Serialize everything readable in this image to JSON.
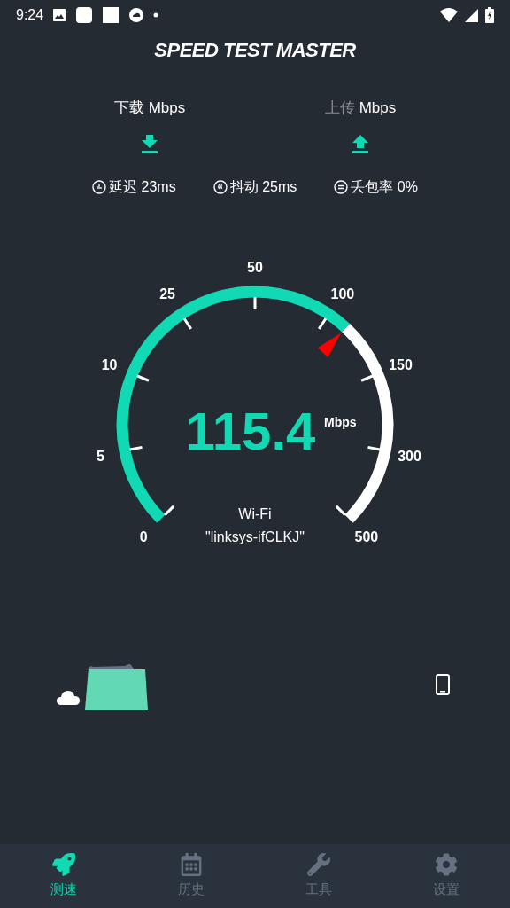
{
  "status_bar": {
    "time": "9:24"
  },
  "app_title": "SPEED TEST MASTER",
  "directions": [
    {
      "kind": "download",
      "label": "下载",
      "unit": "Mbps",
      "active": true
    },
    {
      "kind": "upload",
      "label": "上传",
      "unit": "Mbps",
      "active": false
    }
  ],
  "stats": [
    {
      "kind": "ping",
      "text": "延迟 23ms"
    },
    {
      "kind": "jitter",
      "text": "抖动 25ms"
    },
    {
      "kind": "loss",
      "text": "丢包率 0%"
    }
  ],
  "gauge": {
    "ticks": [
      "0",
      "5",
      "10",
      "25",
      "50",
      "100",
      "150",
      "300",
      "500"
    ],
    "value": "115.4",
    "unit": "Mbps",
    "network": "Wi-Fi",
    "ssid": "\"linksys-ifCLKJ\""
  },
  "nav": [
    {
      "kind": "rocket",
      "label": "测速",
      "selected": true
    },
    {
      "kind": "history",
      "label": "历史",
      "selected": false
    },
    {
      "kind": "tools",
      "label": "工具",
      "selected": false
    },
    {
      "kind": "settings",
      "label": "设置",
      "selected": false
    }
  ]
}
